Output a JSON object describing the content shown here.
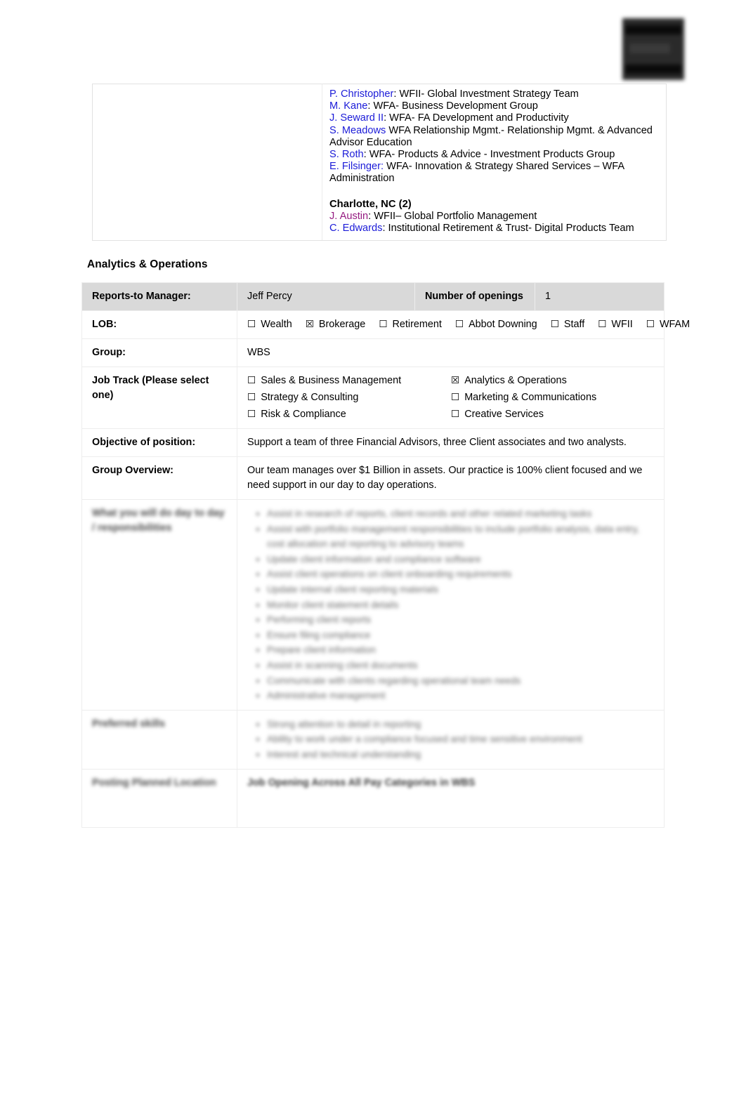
{
  "document": {
    "logo_alt": "redacted-logo"
  },
  "locations_box": {
    "left_cell_text": "",
    "entries": [
      {
        "name": "P. Christopher",
        "separator": ": ",
        "desc": "WFII- Global Investment Strategy Team",
        "color": "blue"
      },
      {
        "name": "M. Kane",
        "separator": ": ",
        "desc": "WFA- Business Development Group",
        "color": "blue"
      },
      {
        "name": "J. Seward II",
        "separator": ": ",
        "desc": "WFA- FA Development and Productivity",
        "color": "blue"
      },
      {
        "name": "S. Meadows",
        "separator": " ",
        "desc": "WFA Relationship Mgmt.- Relationship Mgmt. & Advanced Advisor Education",
        "color": "blue"
      },
      {
        "name": "S. Roth",
        "separator": ": ",
        "desc": "WFA- Products & Advice - Investment Products Group",
        "color": "blue"
      },
      {
        "name": "E. Filsinger:",
        "separator": " ",
        "desc": "WFA- Innovation & Strategy Shared Services – WFA Administration",
        "color": "blue"
      }
    ],
    "city_heading": "Charlotte, NC (2)",
    "city_entries": [
      {
        "name": "J. Austin",
        "separator": ":  ",
        "desc": "WFII– Global Portfolio Management",
        "color": "purple"
      },
      {
        "name": "C. Edwards",
        "separator": ": ",
        "desc": "Institutional Retirement & Trust- Digital Products Team",
        "color": "blue"
      }
    ]
  },
  "section": {
    "heading": "Analytics & Operations"
  },
  "job_table": {
    "reports_to_label": "Reports-to Manager:",
    "reports_to_value": "Jeff Percy",
    "openings_label": "Number of openings",
    "openings_value": "1",
    "lob_label": "LOB:",
    "lob_options": [
      {
        "label": "Wealth",
        "checked": false
      },
      {
        "label": "Brokerage",
        "checked": true
      },
      {
        "label": "Retirement",
        "checked": false
      },
      {
        "label": "Abbot Downing",
        "checked": false
      },
      {
        "label": "Staff",
        "checked": false
      },
      {
        "label": "WFII",
        "checked": false
      },
      {
        "label": "WFAM",
        "checked": false
      }
    ],
    "group_label": "Group:",
    "group_value": "WBS",
    "job_track_label": "Job Track (Please select one)",
    "job_track_options": [
      {
        "label": "Sales & Business Management",
        "checked": false
      },
      {
        "label": "Analytics & Operations",
        "checked": true
      },
      {
        "label": "Strategy & Consulting",
        "checked": false
      },
      {
        "label": "Marketing & Communications",
        "checked": false
      },
      {
        "label": " Risk & Compliance",
        "checked": false
      },
      {
        "label": "Creative Services",
        "checked": false
      }
    ],
    "objective_label": "Objective of position:",
    "objective_value": "Support a team of three Financial Advisors, three Client associates and two analysts.",
    "overview_label": "Group Overview:",
    "overview_value": "Our team manages over $1 Billion in assets. Our practice is 100% client focused and we need support in our day to day operations.",
    "redacted": {
      "responsibilities_label": "What you will do day to day / responsibilities",
      "responsibilities_items": [
        "Assist in research of reports, client records and other related marketing tasks",
        "Assist with portfolio management responsibilities to include portfolio analysis, data entry, cost allocation and reporting to advisory teams",
        "Update client information and compliance software",
        "Assist client operations on client onboarding requirements",
        "Update internal client reporting materials",
        "Monitor client statement details",
        "Performing client reports",
        "Ensure filing compliance",
        "Prepare client information",
        "Assist in scanning client documents",
        "Communicate with clients regarding operational team needs",
        "Administrative management"
      ],
      "qualifications_label": "Preferred skills",
      "qualifications_items": [
        "Strong attention to detail in reporting",
        "Ability to work under a compliance focused and time sensitive environment",
        "Interest and technical understanding"
      ],
      "posting_label": "Posting Planned Location",
      "posting_value": "Job Opening Across All Pay Categories in WBS"
    },
    "checkbox_glyph_unchecked": "☐",
    "checkbox_glyph_checked": "☒"
  },
  "colors": {
    "link_blue": "#1b1bd8",
    "link_purple": "#951b81",
    "header_gray": "#d9d9d9",
    "border_gray": "#ededed"
  }
}
